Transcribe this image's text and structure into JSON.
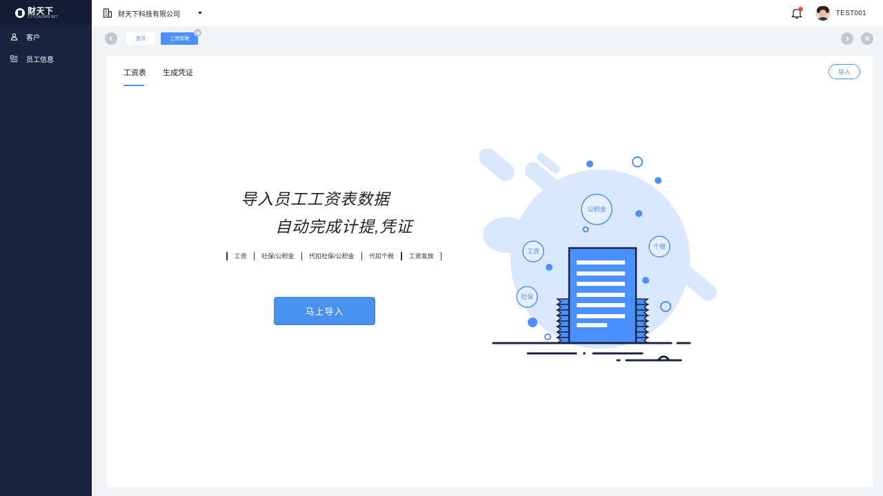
{
  "sidebar": {
    "logo": {
      "title": "财天下",
      "subtitle": "CTY.CAIJIAN.NET"
    },
    "items": [
      {
        "label": "客户",
        "icon": "user-icon"
      },
      {
        "label": "员工信息",
        "icon": "list-icon"
      }
    ]
  },
  "header": {
    "company": "财天下科技有限公司",
    "username": "TEST001",
    "notification_dot_color": "#f0483e"
  },
  "tabs": [
    {
      "label": "首页",
      "active": false
    },
    {
      "label": "工资管理",
      "active": true
    }
  ],
  "panel": {
    "tabs": [
      {
        "label": "工资表",
        "active": true
      },
      {
        "label": "生成凭证",
        "active": false
      }
    ],
    "import_button": "导入",
    "headline_line1": "导入员工工资表数据",
    "headline_line2": "自动完成计提,凭证",
    "features": [
      "工资",
      "社保/公积金",
      "代扣社保/公积金",
      "代扣个税",
      "工资发放"
    ],
    "cta_button": "马上导入",
    "illustration_labels": {
      "fund": "公积金",
      "tax": "个税",
      "salary": "工资",
      "social": "社保"
    }
  },
  "colors": {
    "accent": "#4a90ff",
    "sidebar_bg": "#1a2440",
    "illustration_bg": "#d9e8ff"
  }
}
